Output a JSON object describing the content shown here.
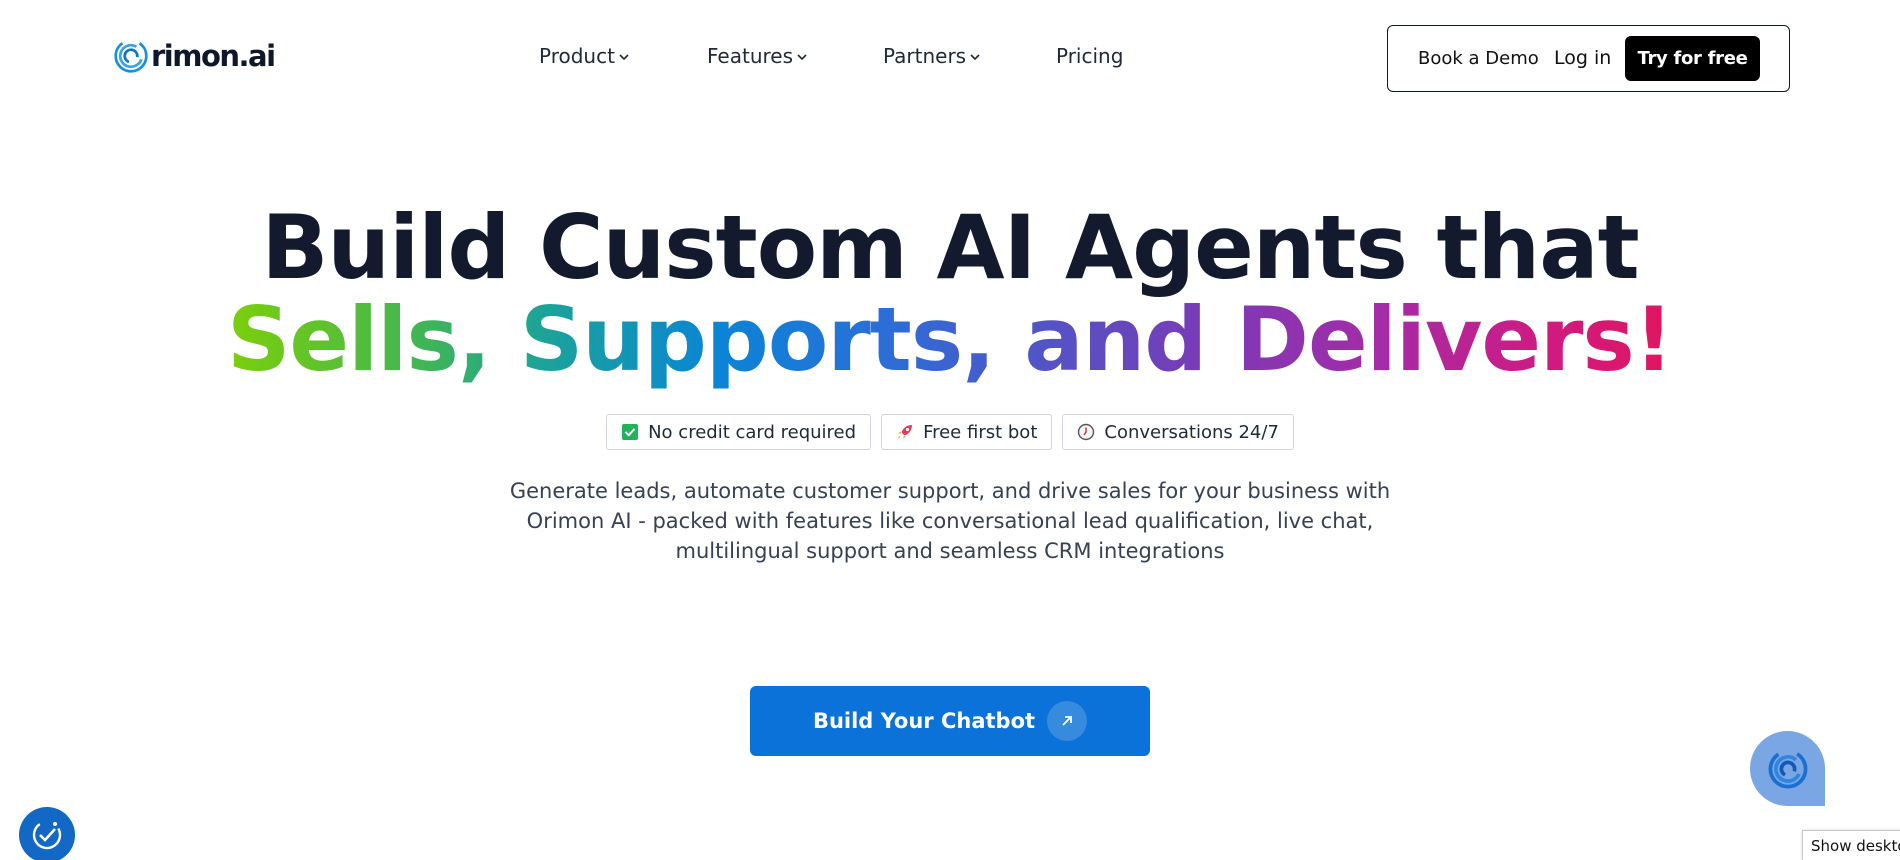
{
  "brand": {
    "logo_text": "rimon.ai",
    "accent": "#0a72d8"
  },
  "nav": {
    "items": [
      {
        "label": "Product",
        "has_dropdown": true
      },
      {
        "label": "Features",
        "has_dropdown": true
      },
      {
        "label": "Partners",
        "has_dropdown": true
      },
      {
        "label": "Pricing",
        "has_dropdown": false
      }
    ]
  },
  "header_actions": {
    "book_demo": "Book a Demo",
    "login": "Log in",
    "try_free": "Try for free"
  },
  "hero": {
    "headline_line1": "Build Custom AI Agents that",
    "headline_line2": "Sells, Supports, and Delivers!",
    "badges": [
      {
        "icon": "checkbox-icon",
        "label": "No credit card required"
      },
      {
        "icon": "rocket-icon",
        "label": "Free first bot"
      },
      {
        "icon": "clock-icon",
        "label": "Conversations 24/7"
      }
    ],
    "description_lines": [
      "Generate leads, automate customer support, and drive sales for your business with",
      "Orimon AI - packed with features like conversational lead qualification, live chat,",
      "multilingual support and seamless CRM integrations"
    ],
    "cta_label": "Build Your Chatbot"
  },
  "overlay": {
    "tooltip": "Show desktop"
  }
}
